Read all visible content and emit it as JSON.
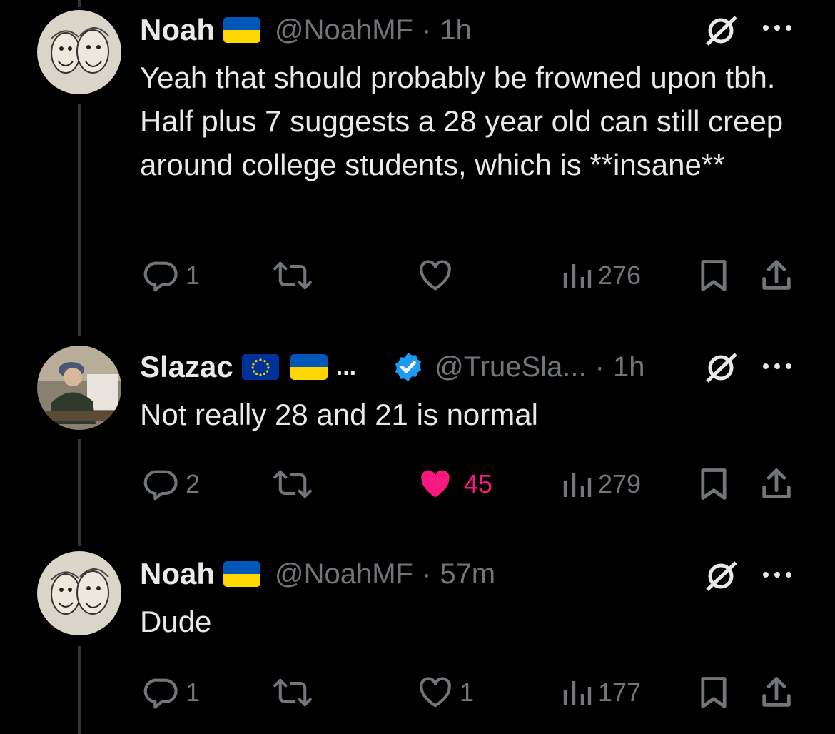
{
  "tweets": [
    {
      "name": "Noah",
      "handle": "@NoahMF",
      "time": "1h",
      "text": "Yeah that should probably be frowned upon tbh. Half plus 7 suggests a 28 year old can still creep around college students, which is **insane**",
      "replies": "1",
      "reposts": "",
      "likes": "",
      "views": "276",
      "liked": false
    },
    {
      "name": "Slazac",
      "ellipsis": "...",
      "handle": "@TrueSla...",
      "time": "1h",
      "text": "Not really 28 and 21 is normal",
      "replies": "2",
      "reposts": "",
      "likes": "45",
      "views": "279",
      "liked": true
    },
    {
      "name": "Noah",
      "handle": "@NoahMF",
      "time": "57m",
      "text": "Dude",
      "replies": "1",
      "reposts": "",
      "likes": "1",
      "views": "177",
      "liked": false
    }
  ],
  "separator": "·",
  "colors": {
    "background": "#000000",
    "text": "#e7e9ea",
    "muted": "#71767b",
    "like": "#f91880",
    "verified": "#1d9bf0",
    "flag_blue": "#0057b7",
    "flag_yellow": "#ffd700",
    "eu_blue": "#003399"
  },
  "icons": [
    "reply-icon",
    "repost-icon",
    "like-icon",
    "views-icon",
    "bookmark-icon",
    "share-icon",
    "grok-icon",
    "more-icon",
    "verified-icon"
  ]
}
